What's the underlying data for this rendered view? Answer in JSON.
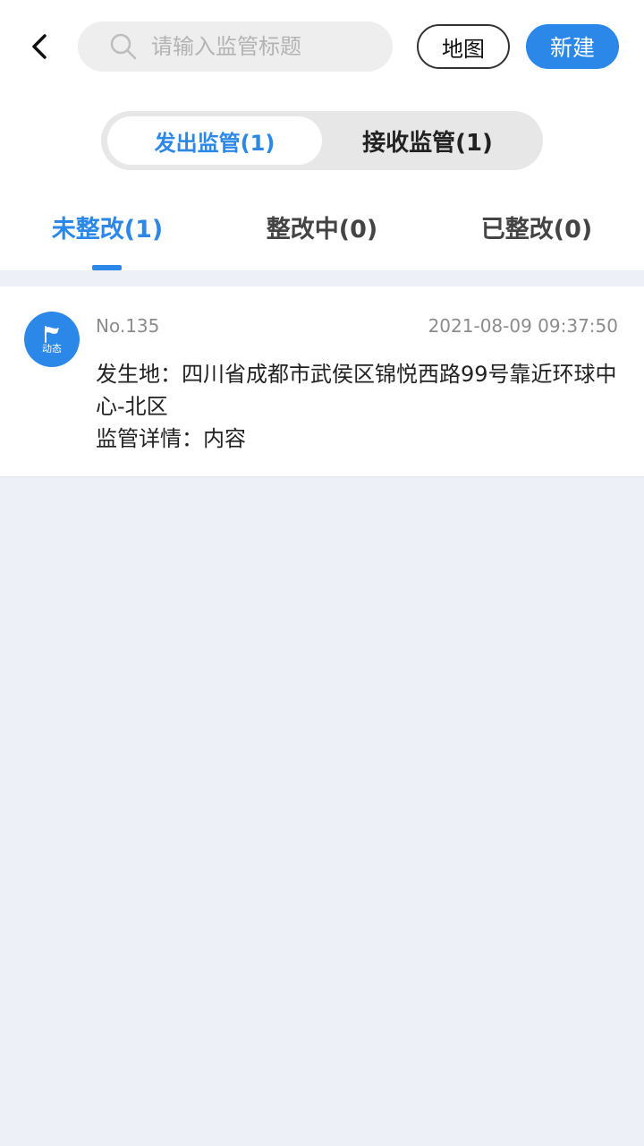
{
  "header": {
    "search_placeholder": "请输入监管标题",
    "map_label": "地图",
    "new_label": "新建"
  },
  "segment": {
    "sent_label": "发出监管(1)",
    "received_label": "接收监管(1)"
  },
  "tabs": [
    {
      "label": "未整改(1)"
    },
    {
      "label": "整改中(0)"
    },
    {
      "label": "已整改(0)"
    }
  ],
  "records": [
    {
      "badge": "动态",
      "no": "No.135",
      "time": "2021-08-09 09:37:50",
      "location_line": "发生地：四川省成都市武侯区锦悦西路99号靠近环球中心-北区",
      "detail_line": "监管详情：内容"
    }
  ],
  "colors": {
    "accent": "#2b88e8",
    "background": "#edf0f7"
  }
}
